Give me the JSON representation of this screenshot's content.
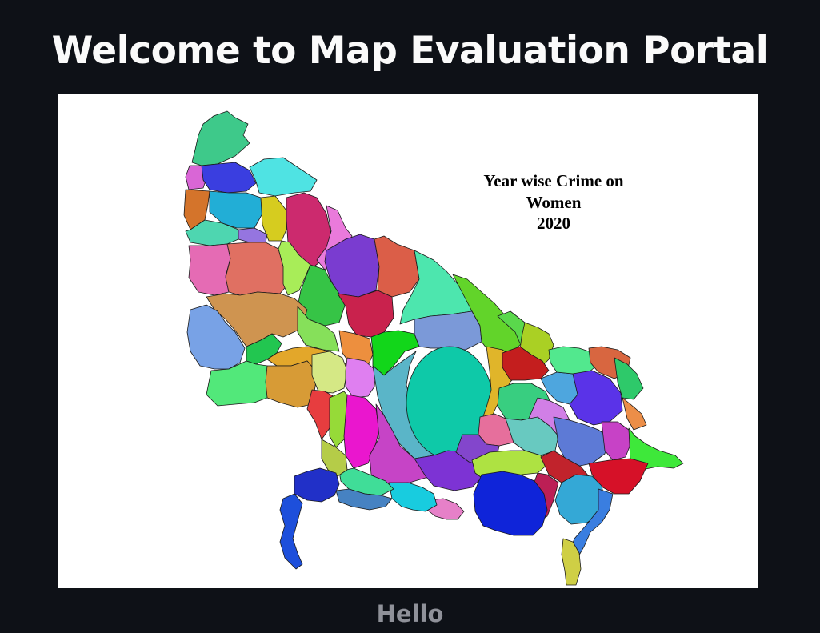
{
  "page": {
    "title": "Welcome to Map Evaluation Portal",
    "caption": "Hello"
  },
  "map": {
    "heading_line1": "Year wise Crime on",
    "heading_line2": "Women",
    "heading_line3": "2020"
  },
  "colors": {
    "app_background": "#0e1117",
    "title_text": "#fafafa",
    "caption_text": "#8f9199",
    "map_background": "#ffffff"
  }
}
